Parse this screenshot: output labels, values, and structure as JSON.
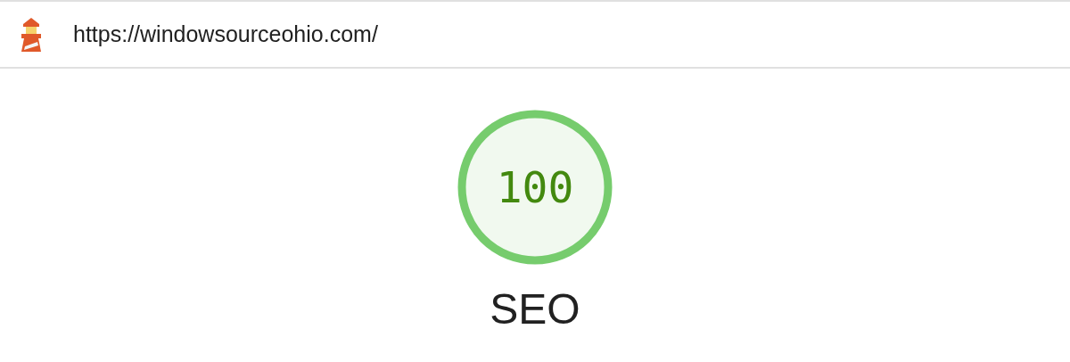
{
  "header": {
    "url": "https://windowsourceohio.com/"
  },
  "gauge": {
    "score": "100",
    "level": 1,
    "label": "SEO"
  }
}
